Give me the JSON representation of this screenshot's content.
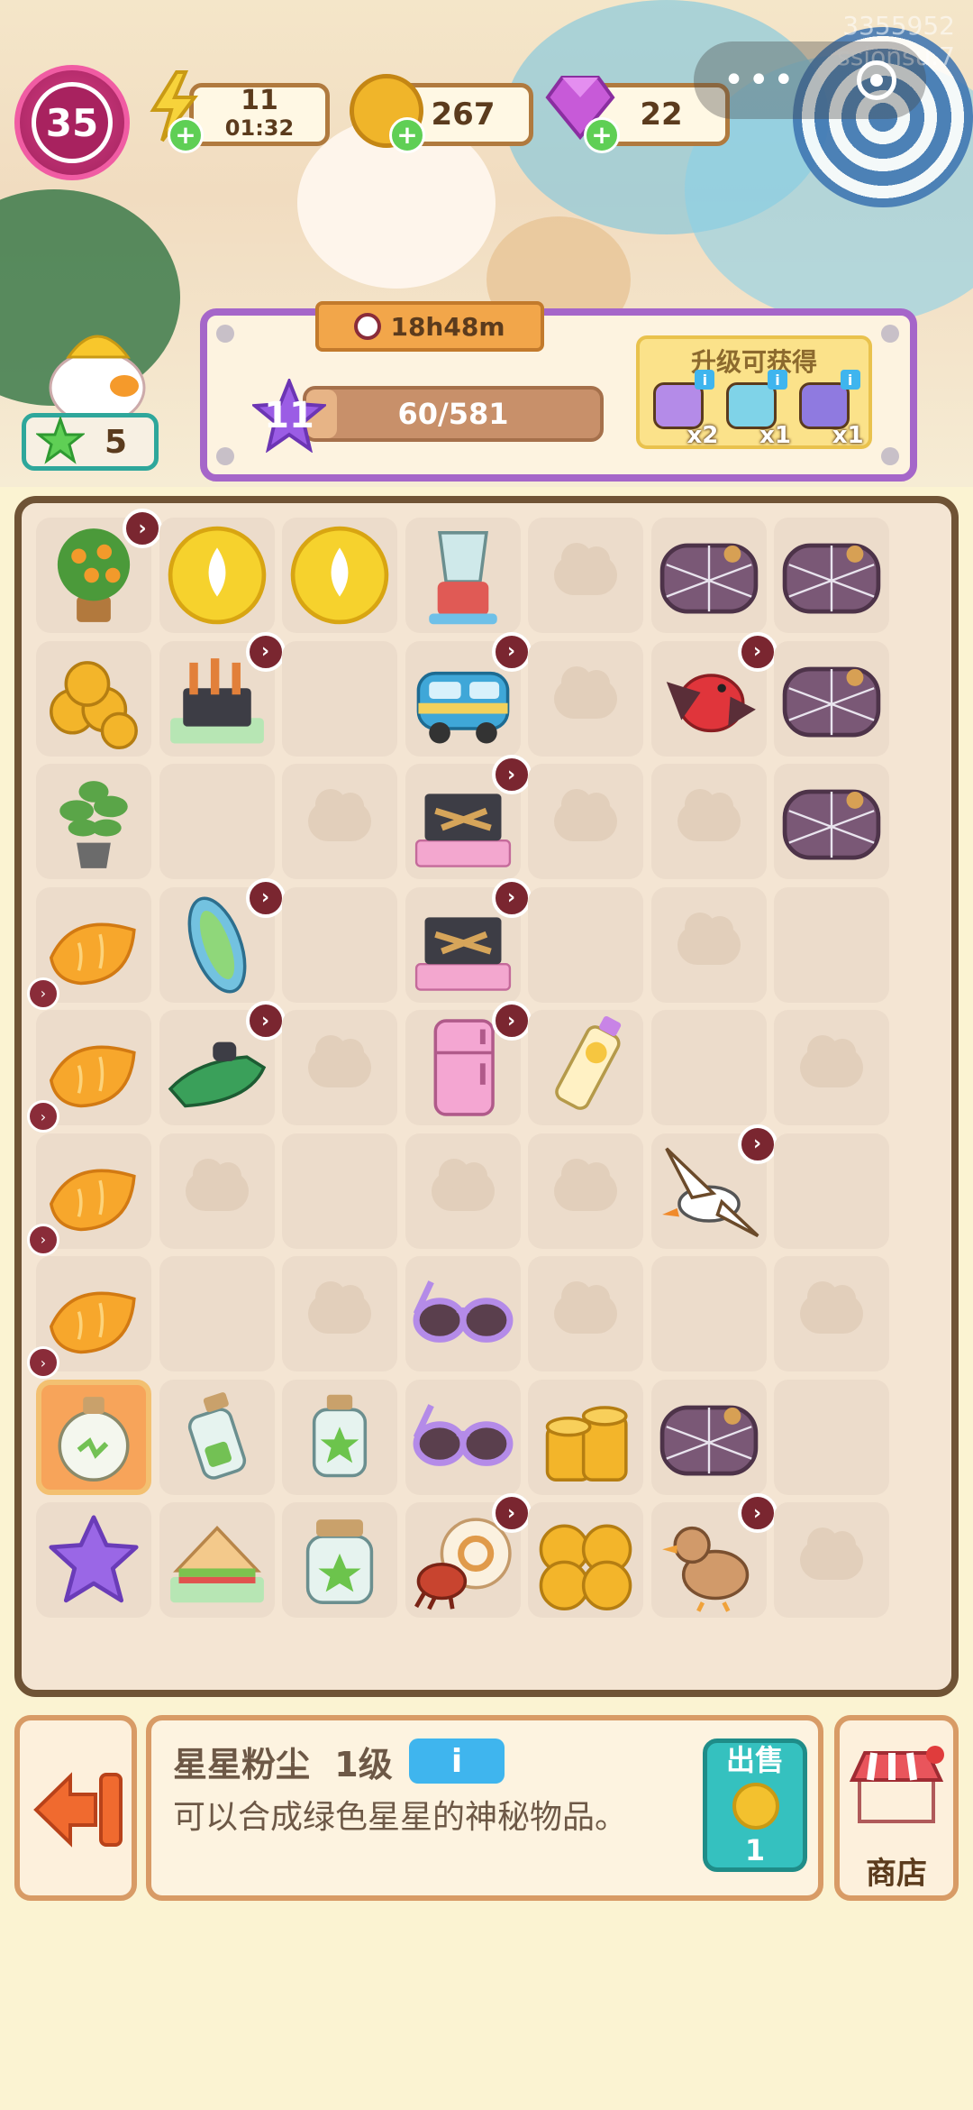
{
  "hud": {
    "level": "35",
    "energy": {
      "value": "11",
      "timer": "01:32"
    },
    "coins": "267",
    "gems": "22",
    "overlay_text": "3355952 ssionsu.7"
  },
  "clover": {
    "count": "5"
  },
  "event": {
    "timer": "18h48m",
    "level": "11",
    "progress_text": "60/581",
    "progress_fraction": 0.103,
    "rewards_title": "升级可获得",
    "rewards": [
      {
        "icon": "shovel-icon",
        "qty": "x2"
      },
      {
        "icon": "bucket-icon",
        "qty": "x1"
      },
      {
        "icon": "water-gun-icon",
        "qty": "x1"
      }
    ]
  },
  "board": {
    "rows": [
      [
        "orange-tree",
        "golden-drop",
        "golden-drop",
        "blender",
        "cloud",
        "webbed-logs",
        "webbed-logs"
      ],
      [
        "coin-pile",
        "bbq-grill-skewers",
        "empty",
        "camper-van",
        "cloud",
        "red-bird",
        "webbed-logs"
      ],
      [
        "potted-plant",
        "empty",
        "cloud",
        "bbq-grill",
        "cloud",
        "cloud",
        "webbed-logs"
      ],
      [
        "orange-slice",
        "surfboard",
        "empty",
        "bbq-grill",
        "empty",
        "cloud",
        "empty"
      ],
      [
        "orange-slice",
        "jet-ski",
        "cloud",
        "pink-fridge",
        "sunscreen",
        "empty",
        "cloud"
      ],
      [
        "orange-slice",
        "cloud",
        "empty",
        "cloud",
        "cloud",
        "seagull",
        "empty"
      ],
      [
        "orange-slice",
        "empty",
        "cloud",
        "sunglasses",
        "cloud",
        "empty",
        "cloud"
      ],
      [
        "lightbulb-jar",
        "small-green-bottle",
        "green-star-bottle",
        "sunglasses",
        "coin-stack",
        "webbed-logs",
        "empty"
      ],
      [
        "purple-star",
        "sandwich",
        "green-star-jar",
        "hermit-crab",
        "coin-pile-large",
        "duck",
        "cloud"
      ]
    ],
    "timer_badges": [
      [
        0,
        0
      ],
      [
        1,
        1
      ],
      [
        1,
        3
      ],
      [
        1,
        5
      ],
      [
        2,
        3
      ],
      [
        3,
        1
      ],
      [
        3,
        3
      ],
      [
        4,
        1
      ],
      [
        4,
        3
      ],
      [
        5,
        5
      ],
      [
        8,
        3
      ],
      [
        8,
        5
      ]
    ],
    "small_badges": [
      [
        3,
        0
      ],
      [
        4,
        0
      ],
      [
        5,
        0
      ],
      [
        6,
        0
      ]
    ],
    "selected": [
      7,
      0
    ]
  },
  "info": {
    "name": "星星粉尘",
    "level": "1级",
    "info_button": "i",
    "description": "可以合成绿色星星的神秘物品。",
    "sell_label": "出售",
    "sell_price": "1",
    "shop_label": "商店"
  },
  "colors": {
    "panel_border": "#a566c9",
    "board_border": "#6f5335",
    "accent_green": "#5fcf55",
    "sell_teal": "#35c1bf"
  }
}
